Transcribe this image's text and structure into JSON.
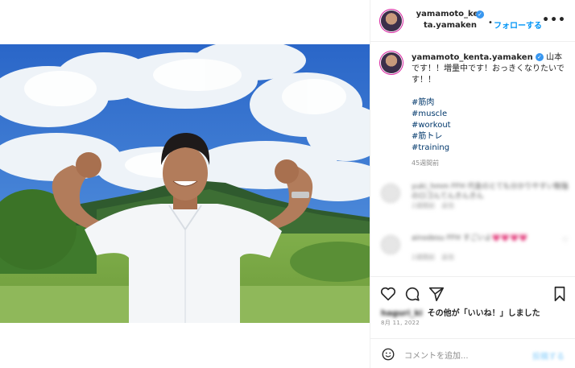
{
  "post": {
    "username_line1": "yamamoto_ken",
    "username_line2": "ta.yamaken",
    "dot": "•",
    "follow_label": "フォローする",
    "more_label": "•••"
  },
  "caption": {
    "username": "yamamoto_kenta.yamaken",
    "text": "山本です！！増量中です！おっきくなりたいです！！",
    "hashtags": [
      "#筋肉",
      "#muscle",
      "#workout",
      "#筋トレ",
      "#training"
    ],
    "time_ago": "45週間前"
  },
  "comments": [
    {
      "text": "yuki_hmm FFH 代金のとても分かりやすい勉強のロゴんてんきんきん",
      "meta": "2週間前　返信"
    },
    {
      "text": "ainodesu FFH すごいよ💗💗💗💗",
      "meta": "2週間前　返信"
    }
  ],
  "actions": {
    "likes_prefix_blurred": "haguri_ki",
    "likes_text": "その他が「いいね！」しました",
    "date": "8月 11, 2022"
  },
  "comment_box": {
    "placeholder": "コメントを追加...",
    "post_label": "投稿する"
  },
  "colors": {
    "link": "#0095f6",
    "hashtag": "#00376b",
    "verified": "#3897f0"
  },
  "icons": [
    "verified-badge-icon",
    "more-icon",
    "heart-icon",
    "comment-icon",
    "share-icon",
    "bookmark-icon",
    "emoji-icon"
  ]
}
